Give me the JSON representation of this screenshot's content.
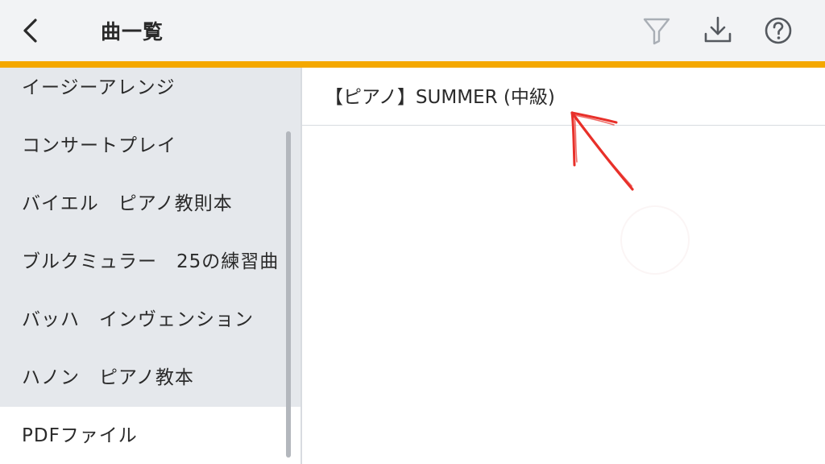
{
  "header": {
    "title": "曲一覧",
    "back_icon": "chevron-left-icon",
    "actions": [
      "filter-icon",
      "download-icon",
      "help-icon"
    ]
  },
  "sidebar": {
    "items": [
      {
        "label": "イージーアレンジ"
      },
      {
        "label": "コンサートプレイ"
      },
      {
        "label": "バイエル　ピアノ教則本"
      },
      {
        "label": "ブルクミュラー　25の練習曲"
      },
      {
        "label": "バッハ　インヴェンション"
      },
      {
        "label": "ハノン　ピアノ教本"
      },
      {
        "label": "PDFファイル",
        "selected": true
      }
    ]
  },
  "content": {
    "songs": [
      {
        "label": "【ピアノ】SUMMER (中級)"
      }
    ]
  },
  "colors": {
    "accent": "#f4a800",
    "annotation": "#e8302a"
  }
}
